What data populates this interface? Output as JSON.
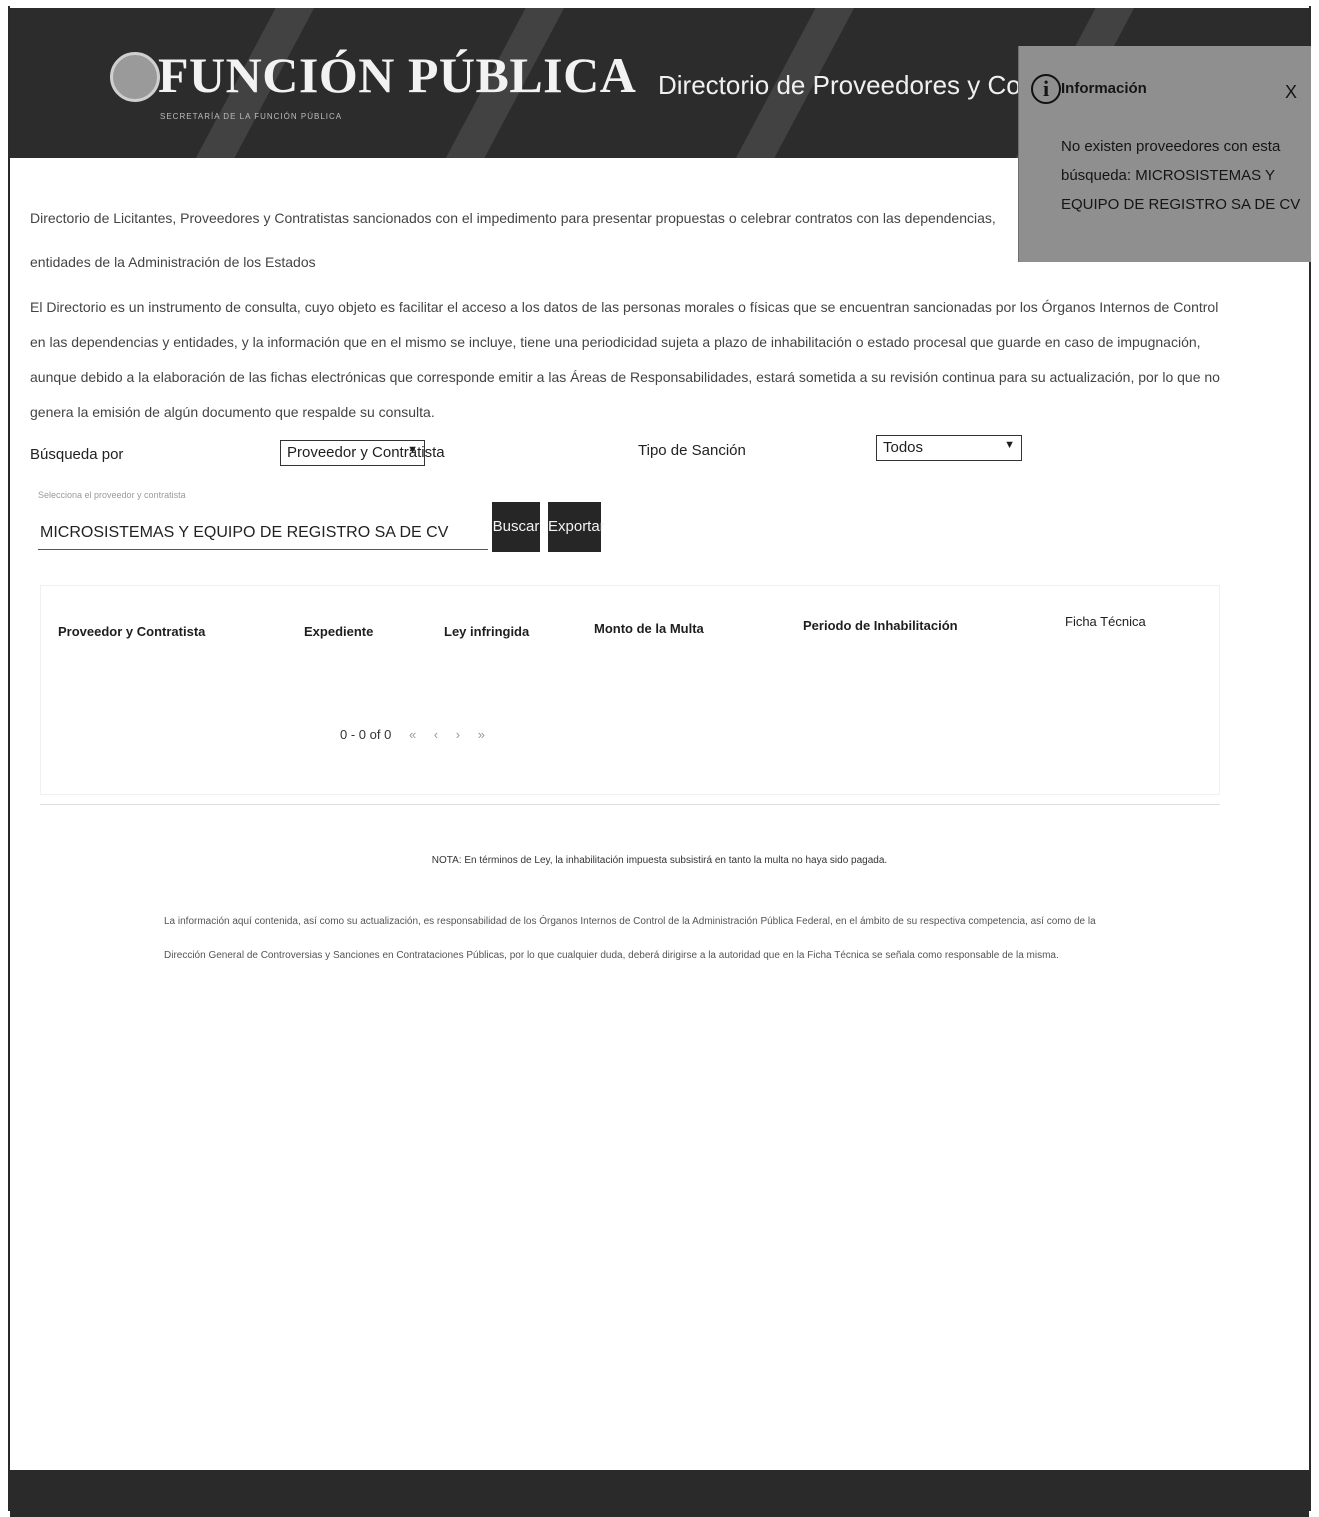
{
  "header": {
    "logo_title": "FUNCIÓN PÚBLICA",
    "logo_subtitle": "SECRETARÍA DE LA FUNCIÓN PÚBLICA",
    "page_title": "Directorio de Proveedores y Contratistas Sanci"
  },
  "popup": {
    "title": "Información",
    "close": "X",
    "message": "No existen proveedores con esta búsqueda: MICROSISTEMAS Y EQUIPO DE REGISTRO SA DE CV"
  },
  "intro": {
    "paragraph1": "Directorio de Licitantes, Proveedores y Contratistas sancionados con el impedimento para presentar propuestas o celebrar contratos con las dependencias, entidades de la Administración de los Estados",
    "paragraph2": "El Directorio es un instrumento de consulta, cuyo objeto es facilitar el acceso a los datos de las personas morales o físicas que se encuentran sancionadas por los Órganos Internos de Control en las dependencias y entidades, y la información que en el mismo se incluye, tiene una periodicidad sujeta a plazo de inhabilitación o estado procesal que guarde en caso de impugnación, aunque debido a la elaboración de las fichas electrónicas que corresponde emitir a las Áreas de Responsabilidades, estará sometida a su revisión continua para su actualización, por lo que no genera la emisión de algún documento que respalde su consulta."
  },
  "search": {
    "search_by_label": "Búsqueda por",
    "search_by_value": "Proveedor y Contratista",
    "sanction_type_label": "Tipo de Sanción",
    "sanction_type_value": "Todos",
    "hint": "Selecciona el proveedor y contratista",
    "query": "MICROSISTEMAS Y EQUIPO DE REGISTRO SA DE CV",
    "search_button": "Buscar",
    "export_button": "Exportar"
  },
  "table": {
    "columns": [
      "Proveedor y Contratista",
      "Expediente",
      "Ley infringida",
      "Monto de la Multa",
      "Periodo de Inhabilitación",
      "Ficha Técnica"
    ],
    "pagination": "0 - 0 of 0",
    "first": "«",
    "prev": "‹",
    "next": "›",
    "last": "»"
  },
  "footer": {
    "note": "NOTA: En términos de Ley, la inhabilitación impuesta subsistirá en tanto la multa no haya sido pagada.",
    "info": "La información aquí contenida, así como su actualización, es responsabilidad de los Órganos Internos de Control de la Administración Pública Federal, en el ámbito de su respectiva competencia, así como de la Dirección General de Controversias y Sanciones en Contrataciones Públicas, por lo que cualquier duda, deberá dirigirse a la autoridad que en la Ficha Técnica se señala como responsable de la misma."
  },
  "colors": {
    "header_bg": "#2c2c2c",
    "button_bg": "#262626",
    "popup_bg": "#8f8f8f"
  }
}
